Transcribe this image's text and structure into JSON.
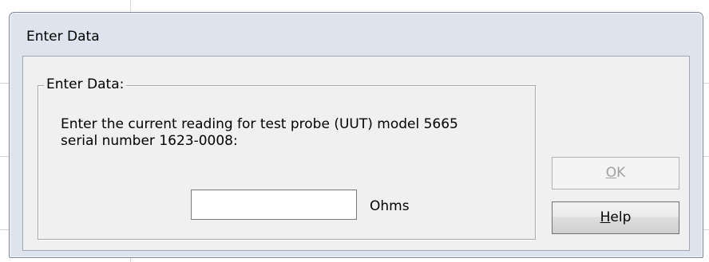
{
  "window": {
    "title": "Enter Data"
  },
  "group": {
    "label": "Enter Data:"
  },
  "prompt": {
    "line1": "Enter the current reading for test probe (UUT) model 5665",
    "line2": "serial number 1623-0008:"
  },
  "input": {
    "value": "",
    "units": "Ohms"
  },
  "buttons": {
    "ok": {
      "mnemonic": "O",
      "rest": "K",
      "enabled": false
    },
    "help": {
      "mnemonic": "H",
      "rest": "elp",
      "enabled": true
    }
  },
  "colors": {
    "dialog_frame": "#dde4ed",
    "client_bg": "#f0f0f0",
    "disabled_text": "#a0a0a0"
  }
}
